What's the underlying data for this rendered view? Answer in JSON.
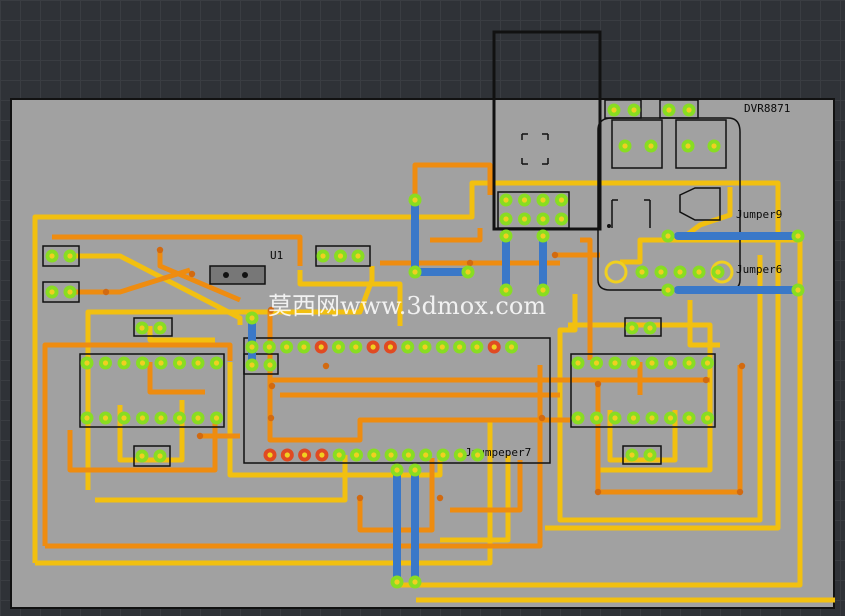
{
  "board": {
    "labels": {
      "driver": "DVR8871",
      "u1": "U1",
      "jumper9": "Jumper9",
      "jumper6": "Jumper6",
      "overlap": "Juumpeper7"
    },
    "watermark": "莫西网www.3dmox.com"
  },
  "colors": {
    "board": "#a1a1a1",
    "trace_orange": "#ee8c10",
    "trace_yellow": "#f2c010",
    "jumper_blue": "#3a78c8",
    "pad_green": "#88dd22",
    "pad_red": "#e04a22",
    "pad_core": "#f0d020",
    "outline": "#111111"
  },
  "icons": [
    "via-pad",
    "ic-footprint",
    "jumper-wire",
    "header-pin"
  ]
}
